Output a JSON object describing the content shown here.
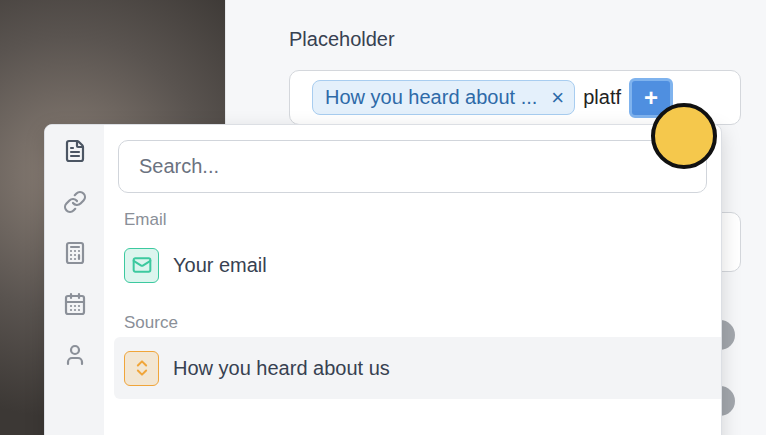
{
  "panel": {
    "label": "Placeholder",
    "chip": {
      "label": "How you heard about ...",
      "remove": "×"
    },
    "typed": "platf",
    "add_button": "+"
  },
  "popup": {
    "rail": [
      {
        "selected": true
      },
      {
        "selected": false
      },
      {
        "selected": false
      },
      {
        "selected": false
      },
      {
        "selected": false
      }
    ],
    "search": {
      "placeholder": "Search..."
    },
    "groups": [
      {
        "label": "Email",
        "items": [
          {
            "label": "Your email",
            "kind": "email",
            "highlighted": false,
            "color": "#3cc99f"
          }
        ]
      },
      {
        "label": "Source",
        "items": [
          {
            "label": "How you heard about us",
            "kind": "select",
            "highlighted": true,
            "color": "#f0a53a"
          }
        ]
      }
    ]
  }
}
